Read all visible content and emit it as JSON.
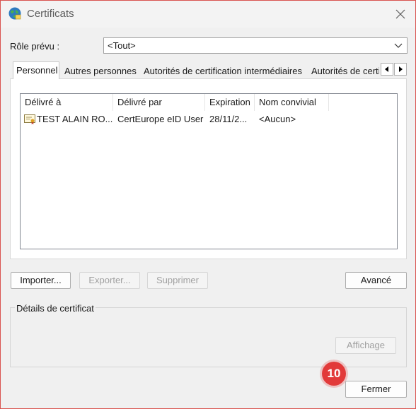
{
  "window": {
    "title": "Certificats"
  },
  "role": {
    "label": "Rôle prévu :",
    "value": "<Tout>"
  },
  "tabs": [
    {
      "label": "Personnel"
    },
    {
      "label": "Autres personnes"
    },
    {
      "label": "Autorités de certification intermédiaires"
    },
    {
      "label": "Autorités de certi"
    }
  ],
  "list": {
    "columns": [
      "Délivré à",
      "Délivré par",
      "Expiration",
      "Nom convivial"
    ],
    "rows": [
      {
        "issued_to": "TEST ALAIN RO...",
        "issued_by": "CertEurope eID User",
        "expiration": "28/11/2...",
        "friendly_name": "<Aucun>"
      }
    ]
  },
  "buttons": {
    "import": "Importer...",
    "export": "Exporter...",
    "delete": "Supprimer",
    "advanced": "Avancé",
    "view": "Affichage",
    "close": "Fermer"
  },
  "details": {
    "label": "Détails de certificat"
  },
  "annotation": {
    "step": "10"
  },
  "colors": {
    "badge": "#e23a3a",
    "window_border": "#d9534f"
  }
}
